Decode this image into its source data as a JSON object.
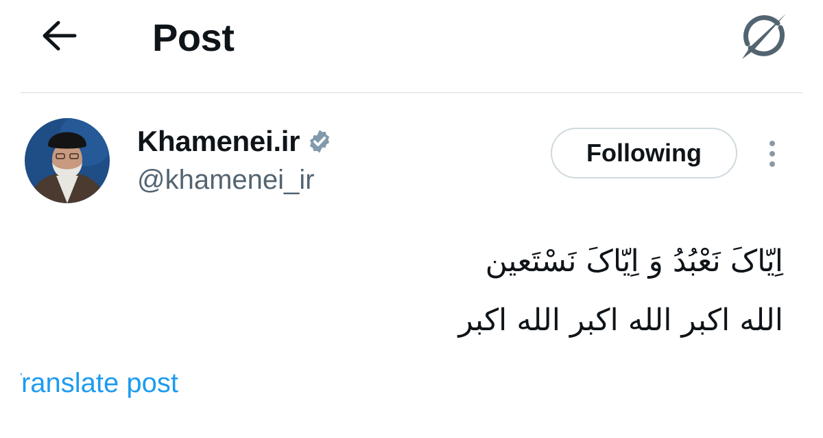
{
  "header": {
    "title": "Post",
    "back_icon": "arrow-left-icon",
    "grok_icon": "grok-slash-circle-icon"
  },
  "author": {
    "name": "Khamenei.ir",
    "handle": "@khamenei_ir",
    "verified_icon": "verified-badge-icon",
    "verified_color": "#829aab"
  },
  "follow_button": {
    "label": "Following"
  },
  "more_icon": "more-vertical-icon",
  "post": {
    "lines": [
      "اِیّاکَ نَعْبُدُ وَ اِیّاکَ نَسْتَعین",
      "الله اکبر الله اکبر الله اکبر"
    ]
  },
  "translate_link": {
    "label": "Translate post"
  },
  "colors": {
    "text_primary": "#0f1419",
    "text_secondary": "#536471",
    "link": "#1d9bf0",
    "border": "#cfd9de"
  }
}
